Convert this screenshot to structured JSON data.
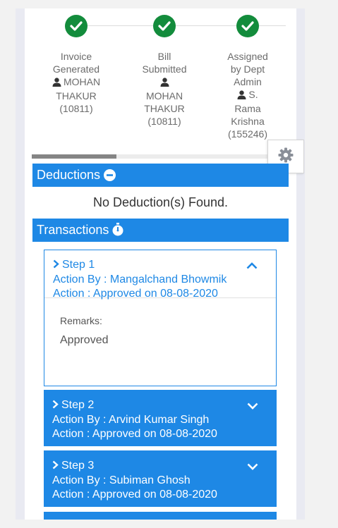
{
  "workflow": {
    "steps": [
      {
        "title_lines": [
          "Invoice",
          "Generated"
        ],
        "user_lines": [
          "MOHAN",
          "THAKUR",
          "(10811)"
        ]
      },
      {
        "title_lines": [
          "Bill",
          "Submitted"
        ],
        "user_lines": [
          "",
          "MOHAN",
          "THAKUR",
          "(10811)"
        ]
      },
      {
        "title_lines": [
          "Assigned",
          "by Dept",
          "Admin"
        ],
        "user_lines": [
          "S.",
          "Rama",
          "Krishna",
          "(155246)"
        ]
      }
    ],
    "status_color": "#138c3c"
  },
  "deductions": {
    "title": "Deductions",
    "empty_text": "No Deduction(s) Found."
  },
  "transactions": {
    "title": "Transactions",
    "items": [
      {
        "step": "Step 1",
        "action_by": "Action By : Mangalchand Bhowmik",
        "action": "Action : Approved on 08-08-2020",
        "expanded": true,
        "remarks_label": "Remarks:",
        "remarks_value": "Approved"
      },
      {
        "step": "Step 2",
        "action_by": "Action By : Arvind Kumar Singh",
        "action": "Action : Approved on 08-08-2020",
        "expanded": false
      },
      {
        "step": "Step 3",
        "action_by": "Action By : Subiman Ghosh",
        "action": "Action : Approved on 08-08-2020",
        "expanded": false
      }
    ]
  },
  "accent_color": "#1e88e5"
}
